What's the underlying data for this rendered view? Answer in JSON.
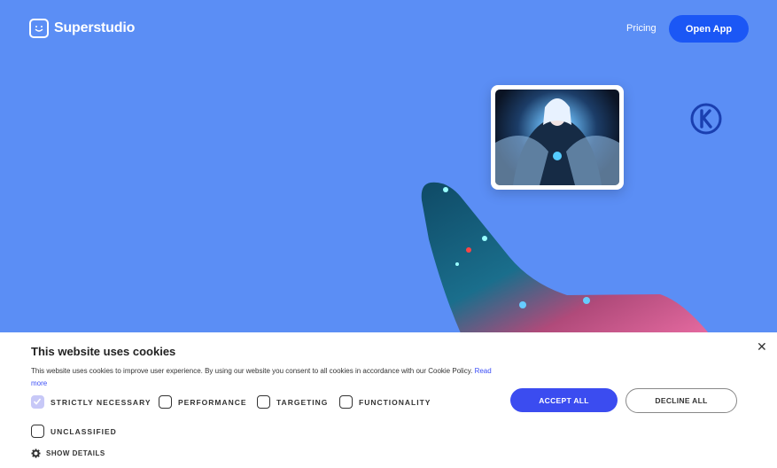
{
  "brand": {
    "name": "Superstudio"
  },
  "nav": {
    "pricing": "Pricing",
    "open_app": "Open App"
  },
  "colors": {
    "background": "#5b8ef5",
    "accent": "#1b57f5",
    "accept": "#3b4cf0"
  },
  "cookie_banner": {
    "title": "This website uses cookies",
    "description": "This website uses cookies to improve user experience. By using our website you consent to all cookies in accordance with our Cookie Policy.",
    "read_more": "Read more",
    "options": [
      {
        "label": "STRICTLY NECESSARY",
        "checked": true
      },
      {
        "label": "PERFORMANCE",
        "checked": false
      },
      {
        "label": "TARGETING",
        "checked": false
      },
      {
        "label": "FUNCTIONALITY",
        "checked": false
      },
      {
        "label": "UNCLASSIFIED",
        "checked": false
      }
    ],
    "accept_all": "ACCEPT ALL",
    "decline_all": "DECLINE ALL",
    "show_details": "SHOW DETAILS",
    "close_icon": "close-icon"
  }
}
